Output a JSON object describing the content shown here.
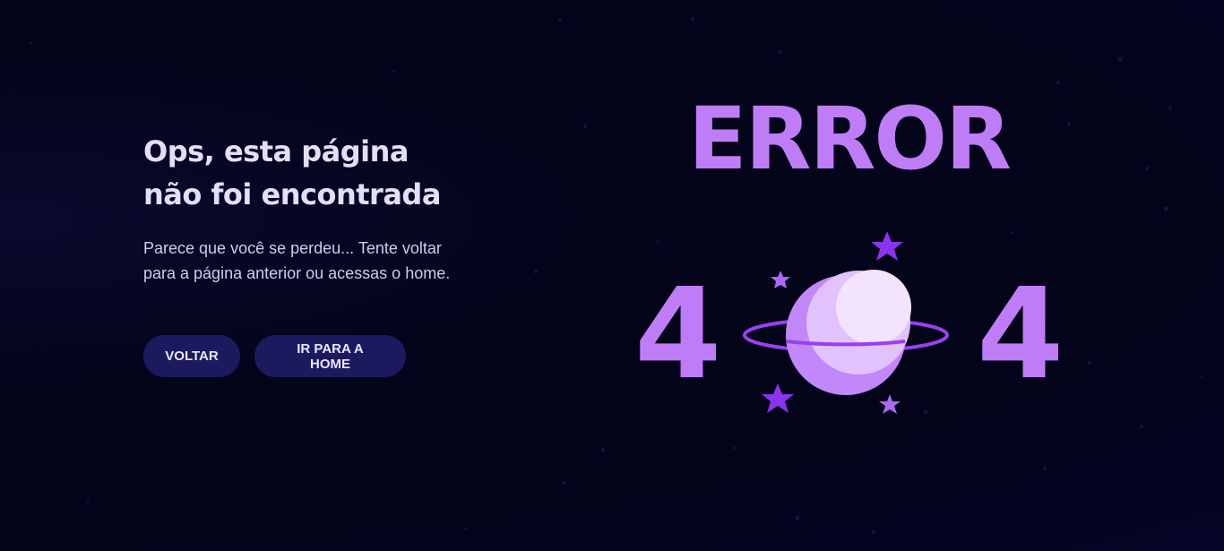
{
  "page": {
    "title_line1": "Ops, esta página",
    "title_line2": "não foi encontrada",
    "description_line1": "Parece que você se perdeu... Tente voltar",
    "description_line2": "para a página anterior ou acessas o home."
  },
  "buttons": {
    "back_label": "VOLTAR",
    "home_label": "IR PARA A HOME"
  },
  "illustration": {
    "error_label": "ERROR",
    "left_digit": "4",
    "right_digit": "4",
    "planet_icon": "planet-icon",
    "star_icon": "star-icon"
  },
  "colors": {
    "background": "#04041a",
    "accent": "#bf7cf7",
    "button_bg": "#1c1a5e",
    "title": "#e2defb"
  }
}
